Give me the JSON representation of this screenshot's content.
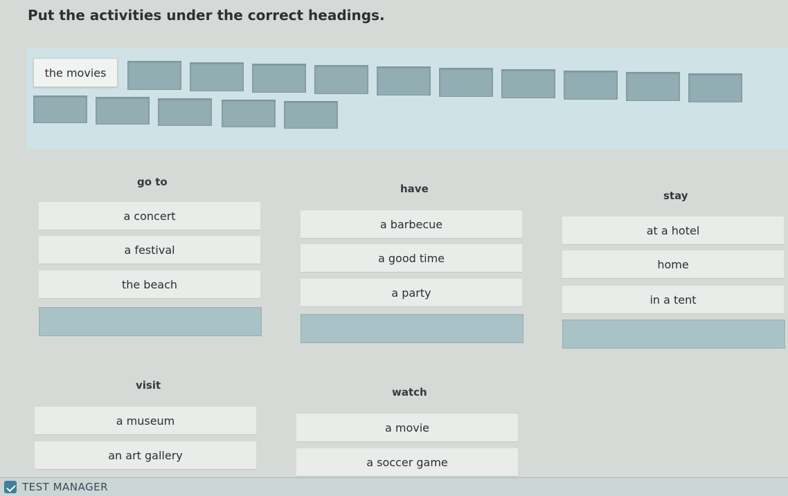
{
  "instruction": "Put the activities under the correct headings.",
  "bank": {
    "chips": [
      "the movies"
    ],
    "empty_slots": 15
  },
  "groups": [
    {
      "heading": "go to",
      "items": [
        "a concert",
        "a festival",
        "the beach"
      ]
    },
    {
      "heading": "have",
      "items": [
        "a barbecue",
        "a good time",
        "a party"
      ]
    },
    {
      "heading": "stay",
      "items": [
        "at a hotel",
        "home",
        "in a tent"
      ]
    },
    {
      "heading": "visit",
      "items": [
        "a museum",
        "an art gallery"
      ]
    },
    {
      "heading": "watch",
      "items": [
        "a movie",
        "a soccer game"
      ]
    }
  ],
  "footer": {
    "brand": "TEST MANAGER"
  },
  "colors": {
    "bank_bg": "#cfe2e6",
    "slot": "#93aeb3",
    "drop_zone": "#a9c2c6"
  }
}
